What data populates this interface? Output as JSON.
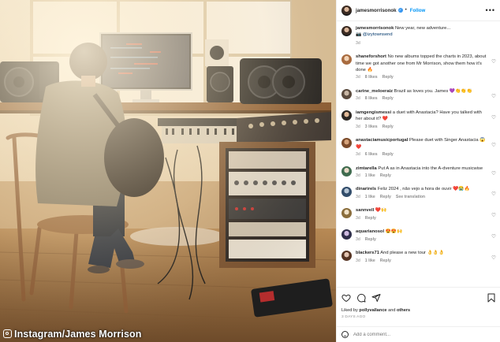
{
  "watermark": "Instagram/James Morrison",
  "post": {
    "username": "jamesmorrisonok",
    "follow_label": "Follow",
    "dot": "•",
    "more": "•••",
    "caption": {
      "username": "jamesmorrisonok",
      "text": "New year, new adventure...",
      "credit_icon": "📷",
      "credit_mention": "@izytownsend",
      "time": "3d"
    }
  },
  "comments": [
    {
      "username": "shaneforshort",
      "text": "No new albums topped the charts in 2023, about time we got another one from Mr Morrison, show them how it's done 🔥",
      "time": "3d",
      "likes": "8 likes",
      "reply": "Reply"
    },
    {
      "username": "carine_meloeraiz",
      "text": "Brazil as loves you. James 💜👏👏👏",
      "time": "3d",
      "likes": "8 likes",
      "reply": "Reply"
    },
    {
      "username": "iamgengismessi",
      "text": "a duet with Anastacia? Have you talked with her about it? ❤️",
      "time": "3d",
      "likes": "3 likes",
      "reply": "Reply"
    },
    {
      "username": "anastaciamusicportugal",
      "text": "Please duet with Singer Anastacia 😱❤️",
      "time": "3d",
      "likes": "6 likes",
      "reply": "Reply"
    },
    {
      "username": "zimtarella",
      "text": "Put A as in Anastacia into the A-dventure musicwise",
      "time": "3d",
      "likes": "1 like",
      "reply": "Reply"
    },
    {
      "username": "dinarirels",
      "text": "Feliz 2024 , não vejo a hora de ouvir ❤️😭🔥",
      "time": "3d",
      "likes": "1 like",
      "reply": "Reply",
      "extra": "See translation"
    },
    {
      "username": "sannvell",
      "text": "❤️🙌",
      "time": "3d",
      "likes": "",
      "reply": "Reply"
    },
    {
      "username": "aquarianosol",
      "text": "😍😍🙌",
      "time": "3d",
      "likes": "",
      "reply": "Reply"
    },
    {
      "username": "blackers71",
      "text": "And please a new tour 👌👌👌",
      "time": "3d",
      "likes": "1 like",
      "reply": "Reply"
    }
  ],
  "actions": {
    "liked_by_prefix": "Liked by",
    "liked_by_user": "pollyvallance",
    "and": "and",
    "others": "others",
    "posted_ago": "3 DAYS AGO"
  },
  "add_comment": {
    "placeholder": "Add a comment..."
  }
}
